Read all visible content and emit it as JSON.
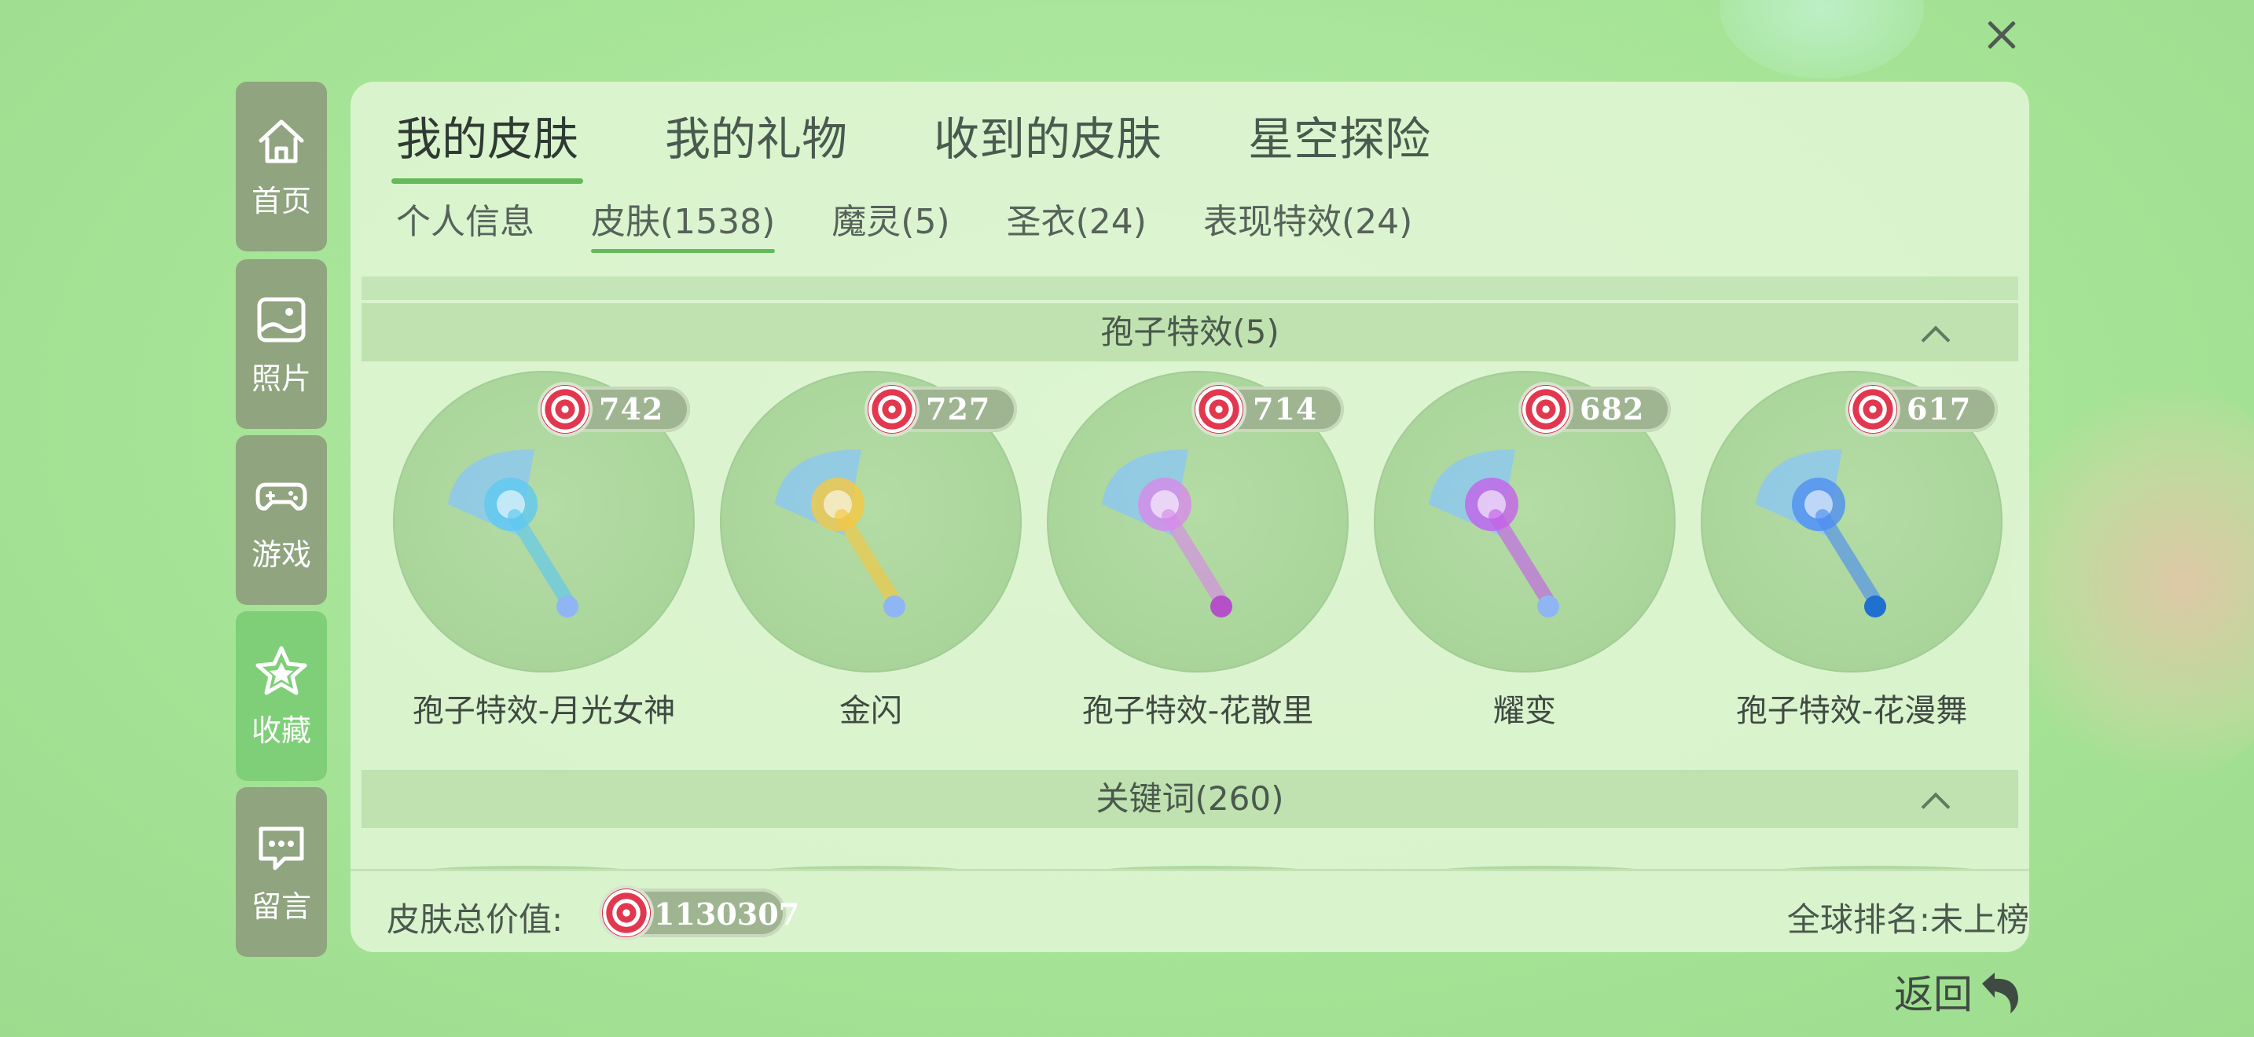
{
  "sidebar": {
    "items": [
      {
        "label": "首页",
        "icon": "home-icon"
      },
      {
        "label": "照片",
        "icon": "photo-icon"
      },
      {
        "label": "游戏",
        "icon": "gamepad-icon"
      },
      {
        "label": "收藏",
        "icon": "star-icon",
        "active": true
      },
      {
        "label": "留言",
        "icon": "message-icon"
      }
    ]
  },
  "tabs": [
    {
      "label": "我的皮肤",
      "active": true
    },
    {
      "label": "我的礼物"
    },
    {
      "label": "收到的皮肤"
    },
    {
      "label": "星空探险"
    }
  ],
  "subtabs": [
    {
      "label": "个人信息"
    },
    {
      "label": "皮肤(1538)",
      "active": true
    },
    {
      "label": "魔灵(5)"
    },
    {
      "label": "圣衣(24)"
    },
    {
      "label": "表现特效(24)"
    }
  ],
  "sections": {
    "spore": {
      "title": "孢子特效(5)",
      "items": [
        {
          "name": "孢子特效-月光女神",
          "value": "742",
          "color": "#5fc8f0",
          "dot": "#8fb6f2"
        },
        {
          "name": "金闪",
          "value": "727",
          "color": "#f5c842",
          "dot": "#8fb6f2"
        },
        {
          "name": "孢子特效-花散里",
          "value": "714",
          "color": "#d88ae8",
          "dot": "#b451c8"
        },
        {
          "name": "耀变",
          "value": "682",
          "color": "#c462e8",
          "dot": "#8fb6f2"
        },
        {
          "name": "孢子特效-花漫舞",
          "value": "617",
          "color": "#4f8ff0",
          "dot": "#2070d0"
        }
      ]
    },
    "keywords": {
      "title": "关键词(260)"
    }
  },
  "footer": {
    "total_label": "皮肤总价值:",
    "total_value": "1130307",
    "rank_label": "全球排名:未上榜"
  },
  "back_label": "返回",
  "colors": {
    "accent": "#64b95a",
    "sidebar": "#8fa47f",
    "sidebar_active": "#7fcf78",
    "candy": "#e2384f"
  }
}
